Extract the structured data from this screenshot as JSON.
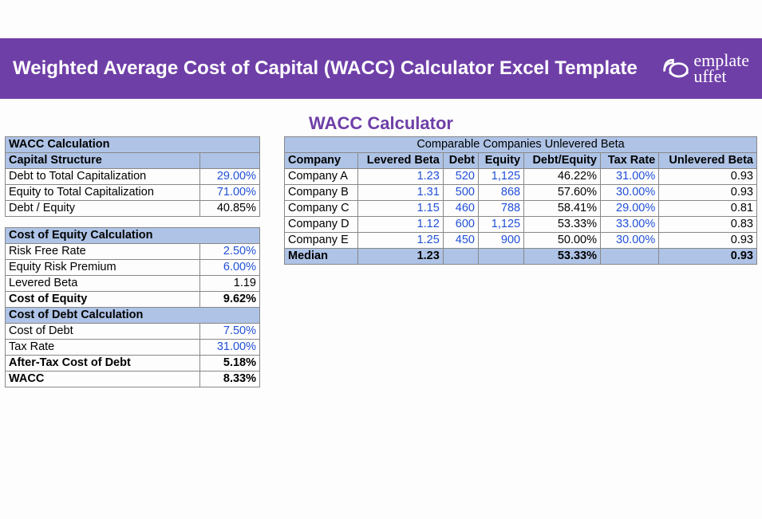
{
  "banner": {
    "title": "Weighted Average Cost of Capital (WACC) Calculator Excel Template",
    "logo_text_top": "emplate",
    "logo_text_bottom": "uffet"
  },
  "sheet_title": "WACC Calculator",
  "left": {
    "wacc_calc_header": "WACC Calculation",
    "capital_structure": "Capital Structure",
    "rows_capital": [
      {
        "label": "Debt to Total Capitalization",
        "value": "29.00%",
        "blue": true
      },
      {
        "label": "Equity to Total Capitalization",
        "value": "71.00%",
        "blue": true
      },
      {
        "label": "Debt / Equity",
        "value": "40.85%",
        "blue": false
      }
    ],
    "cost_equity_header": "Cost of Equity Calculation",
    "rows_equity": [
      {
        "label": "Risk Free Rate",
        "value": "2.50%",
        "blue": true
      },
      {
        "label": "Equity Risk Premium",
        "value": "6.00%",
        "blue": true
      },
      {
        "label": "Levered Beta",
        "value": "1.19",
        "blue": false
      },
      {
        "label": "Cost of Equity",
        "value": "9.62%",
        "blue": false,
        "bold": true
      }
    ],
    "cost_debt_header": "Cost of Debt Calculation",
    "rows_debt": [
      {
        "label": "Cost of Debt",
        "value": "7.50%",
        "blue": true
      },
      {
        "label": "Tax Rate",
        "value": "31.00%",
        "blue": true
      },
      {
        "label": "After-Tax Cost of Debt",
        "value": "5.18%",
        "blue": false,
        "bold": true
      },
      {
        "label": "WACC",
        "value": "8.33%",
        "blue": false,
        "bold": true
      }
    ]
  },
  "right": {
    "banner": "Comparable Companies Unlevered Beta",
    "headers": [
      "Company",
      "Levered Beta",
      "Debt",
      "Equity",
      "Debt/Equity",
      "Tax Rate",
      "Unlevered Beta"
    ],
    "rows": [
      {
        "company": "Company A",
        "lb": "1.23",
        "debt": "520",
        "equity": "1,125",
        "de": "46.22%",
        "tax": "31.00%",
        "ub": "0.93"
      },
      {
        "company": "Company B",
        "lb": "1.31",
        "debt": "500",
        "equity": "868",
        "de": "57.60%",
        "tax": "30.00%",
        "ub": "0.93"
      },
      {
        "company": "Company C",
        "lb": "1.15",
        "debt": "460",
        "equity": "788",
        "de": "58.41%",
        "tax": "29.00%",
        "ub": "0.81"
      },
      {
        "company": "Company D",
        "lb": "1.12",
        "debt": "600",
        "equity": "1,125",
        "de": "53.33%",
        "tax": "33.00%",
        "ub": "0.83"
      },
      {
        "company": "Company E",
        "lb": "1.25",
        "debt": "450",
        "equity": "900",
        "de": "50.00%",
        "tax": "30.00%",
        "ub": "0.93"
      }
    ],
    "median": {
      "label": "Median",
      "lb": "1.23",
      "de": "53.33%",
      "ub": "0.93"
    }
  }
}
